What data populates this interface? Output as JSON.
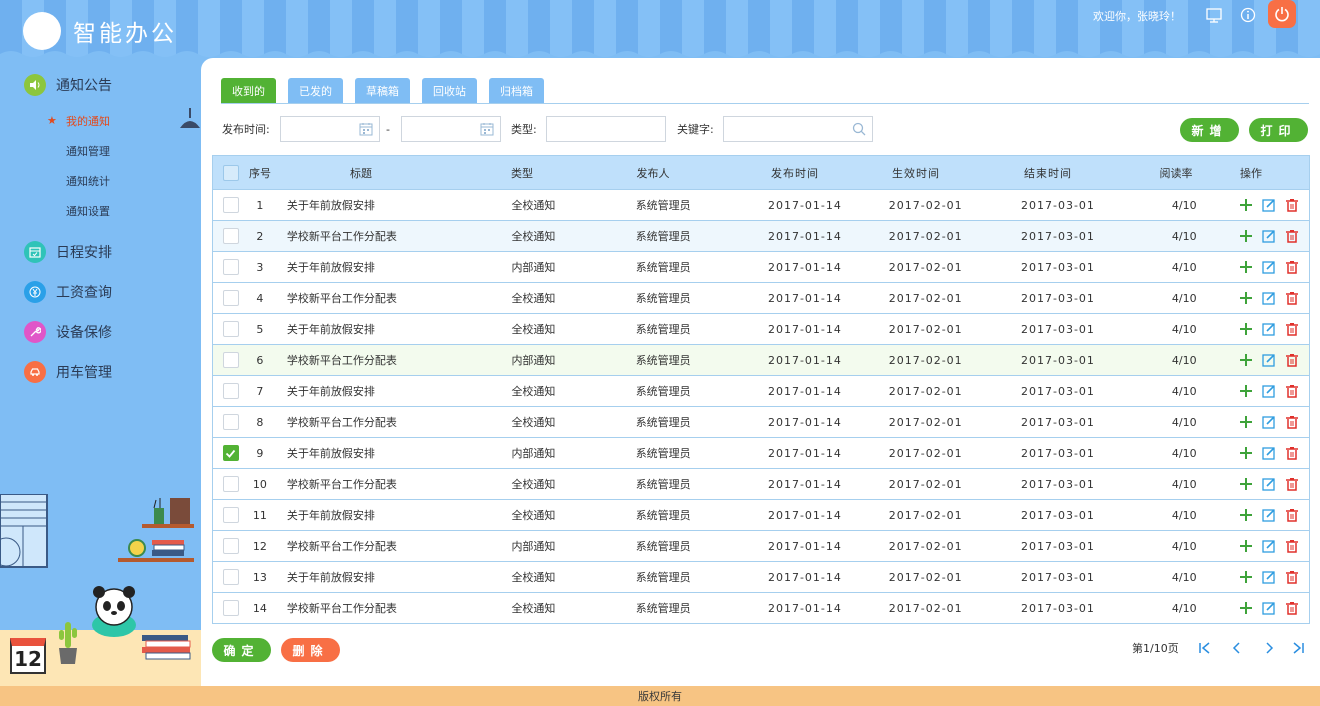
{
  "header": {
    "app_title": "智能办公",
    "welcome": "欢迎你，张晓玲！",
    "icons": [
      "monitor-icon",
      "info-icon",
      "power-icon"
    ]
  },
  "sidebar": {
    "sections": [
      {
        "label": "通知公告",
        "icon": "speaker-icon",
        "color": "#8cc63e"
      },
      {
        "label": "日程安排",
        "icon": "calendar-icon",
        "color": "#2fc3b8"
      },
      {
        "label": "工资查询",
        "icon": "yen-icon",
        "color": "#2aa0e8"
      },
      {
        "label": "设备保修",
        "icon": "wrench-icon",
        "color": "#e056c8"
      },
      {
        "label": "用车管理",
        "icon": "car-icon",
        "color": "#f86f45"
      }
    ],
    "sub_items": [
      "我的通知",
      "通知管理",
      "通知统计",
      "通知设置"
    ],
    "calendar_day": "12"
  },
  "tabs": [
    "收到的",
    "已发的",
    "草稿箱",
    "回收站",
    "归档箱"
  ],
  "filters": {
    "publish_time_label": "发布时间:",
    "range_sep": "-",
    "type_label": "类型:",
    "keyword_label": "关键字:"
  },
  "buttons": {
    "add": "新增",
    "print": "打印",
    "confirm": "确定",
    "delete": "删除"
  },
  "table": {
    "columns": [
      "序号",
      "标题",
      "类型",
      "发布人",
      "发布时间",
      "生效时间",
      "结束时间",
      "阅读率",
      "操作"
    ],
    "rows": [
      {
        "no": "1",
        "title": "关于年前放假安排",
        "type": "全校通知",
        "publisher": "系统管理员",
        "publish": "2017-01-14",
        "effective": "2017-02-01",
        "end": "2017-03-01",
        "rate": "4/10",
        "checked": false
      },
      {
        "no": "2",
        "title": "学校新平台工作分配表",
        "type": "全校通知",
        "publisher": "系统管理员",
        "publish": "2017-01-14",
        "effective": "2017-02-01",
        "end": "2017-03-01",
        "rate": "4/10",
        "checked": false
      },
      {
        "no": "3",
        "title": "关于年前放假安排",
        "type": "内部通知",
        "publisher": "系统管理员",
        "publish": "2017-01-14",
        "effective": "2017-02-01",
        "end": "2017-03-01",
        "rate": "4/10",
        "checked": false
      },
      {
        "no": "4",
        "title": "学校新平台工作分配表",
        "type": "全校通知",
        "publisher": "系统管理员",
        "publish": "2017-01-14",
        "effective": "2017-02-01",
        "end": "2017-03-01",
        "rate": "4/10",
        "checked": false
      },
      {
        "no": "5",
        "title": "关于年前放假安排",
        "type": "全校通知",
        "publisher": "系统管理员",
        "publish": "2017-01-14",
        "effective": "2017-02-01",
        "end": "2017-03-01",
        "rate": "4/10",
        "checked": false
      },
      {
        "no": "6",
        "title": "学校新平台工作分配表",
        "type": "内部通知",
        "publisher": "系统管理员",
        "publish": "2017-01-14",
        "effective": "2017-02-01",
        "end": "2017-03-01",
        "rate": "4/10",
        "checked": false
      },
      {
        "no": "7",
        "title": "关于年前放假安排",
        "type": "全校通知",
        "publisher": "系统管理员",
        "publish": "2017-01-14",
        "effective": "2017-02-01",
        "end": "2017-03-01",
        "rate": "4/10",
        "checked": false
      },
      {
        "no": "8",
        "title": "学校新平台工作分配表",
        "type": "全校通知",
        "publisher": "系统管理员",
        "publish": "2017-01-14",
        "effective": "2017-02-01",
        "end": "2017-03-01",
        "rate": "4/10",
        "checked": false
      },
      {
        "no": "9",
        "title": "关于年前放假安排",
        "type": "内部通知",
        "publisher": "系统管理员",
        "publish": "2017-01-14",
        "effective": "2017-02-01",
        "end": "2017-03-01",
        "rate": "4/10",
        "checked": true
      },
      {
        "no": "10",
        "title": "学校新平台工作分配表",
        "type": "全校通知",
        "publisher": "系统管理员",
        "publish": "2017-01-14",
        "effective": "2017-02-01",
        "end": "2017-03-01",
        "rate": "4/10",
        "checked": false
      },
      {
        "no": "11",
        "title": "关于年前放假安排",
        "type": "全校通知",
        "publisher": "系统管理员",
        "publish": "2017-01-14",
        "effective": "2017-02-01",
        "end": "2017-03-01",
        "rate": "4/10",
        "checked": false
      },
      {
        "no": "12",
        "title": "学校新平台工作分配表",
        "type": "内部通知",
        "publisher": "系统管理员",
        "publish": "2017-01-14",
        "effective": "2017-02-01",
        "end": "2017-03-01",
        "rate": "4/10",
        "checked": false
      },
      {
        "no": "13",
        "title": "关于年前放假安排",
        "type": "全校通知",
        "publisher": "系统管理员",
        "publish": "2017-01-14",
        "effective": "2017-02-01",
        "end": "2017-03-01",
        "rate": "4/10",
        "checked": false
      },
      {
        "no": "14",
        "title": "学校新平台工作分配表",
        "type": "全校通知",
        "publisher": "系统管理员",
        "publish": "2017-01-14",
        "effective": "2017-02-01",
        "end": "2017-03-01",
        "rate": "4/10",
        "checked": false
      }
    ]
  },
  "pager": {
    "text": "第1/10页"
  },
  "footer": {
    "text": "版权所有"
  },
  "colors": {
    "accent_green": "#52b234",
    "accent_orange": "#f86f45",
    "sky": "#7fbdf4",
    "edit_blue": "#2f9de0",
    "delete_red": "#e0302b"
  }
}
